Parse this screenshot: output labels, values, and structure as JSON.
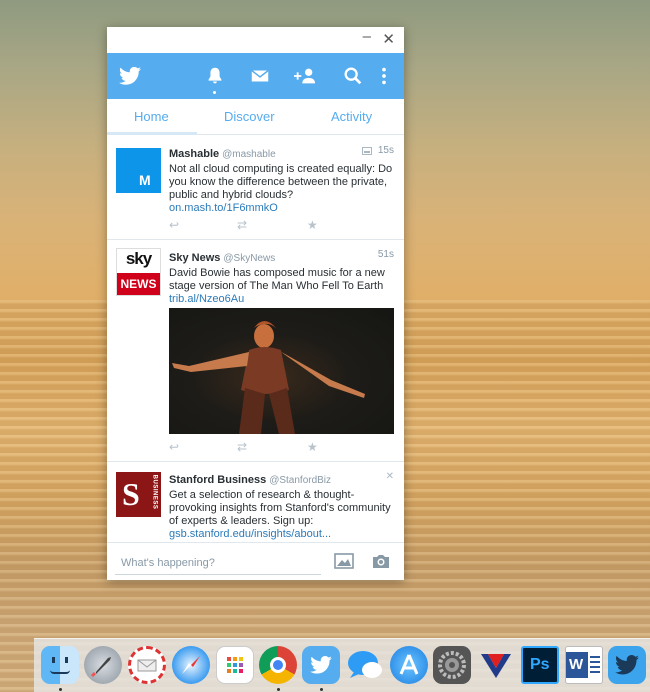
{
  "window": {
    "controls": {
      "minimize": "–",
      "close": "✕"
    }
  },
  "toolbar": {
    "icons": [
      "twitter-logo",
      "notifications-bell-icon",
      "messages-envelope-icon",
      "add-user-icon",
      "search-icon",
      "more-icon"
    ]
  },
  "tabs": [
    {
      "label": "Home"
    },
    {
      "label": "Discover"
    },
    {
      "label": "Activity"
    }
  ],
  "tweets": [
    {
      "name": "Mashable",
      "handle": "@mashable",
      "time": "15s",
      "text": "Not all cloud computing is created equally: Do you know the difference between the private, public and hybrid clouds?",
      "link": "on.mash.to/1F6mmkO",
      "avatar_text": "M",
      "avatar_color": "#0c95e9"
    },
    {
      "name": "Sky News",
      "handle": "@SkyNews",
      "time": "51s",
      "text": "David Bowie has composed music for a new stage version of The Man Who Fell To Earth",
      "link": "trib.al/Nzeo6Au",
      "avatar_top": "sky",
      "avatar_bottom": "NEWS"
    },
    {
      "name": "Stanford Business",
      "handle": "@StanfordBiz",
      "text": "Get a selection of research & thought-provoking insights from Stanford's community of experts & leaders. Sign up:",
      "link": "gsb.stanford.edu/insights/about...",
      "avatar_letter": "S",
      "avatar_side": "BUSINESS",
      "dismiss": "✕"
    }
  ],
  "compose": {
    "placeholder": "What's happening?"
  },
  "dock": {
    "apps": [
      "finder",
      "launchpad",
      "mail-stamp",
      "safari",
      "grid-app",
      "chrome",
      "twitter",
      "messages",
      "app-store",
      "system-preferences",
      "vectorize",
      "photoshop",
      "word",
      "twitter-alt"
    ],
    "ps_label": "Ps",
    "word_label": "W"
  },
  "colors": {
    "accent": "#55acee",
    "link": "#2b7bb9"
  }
}
